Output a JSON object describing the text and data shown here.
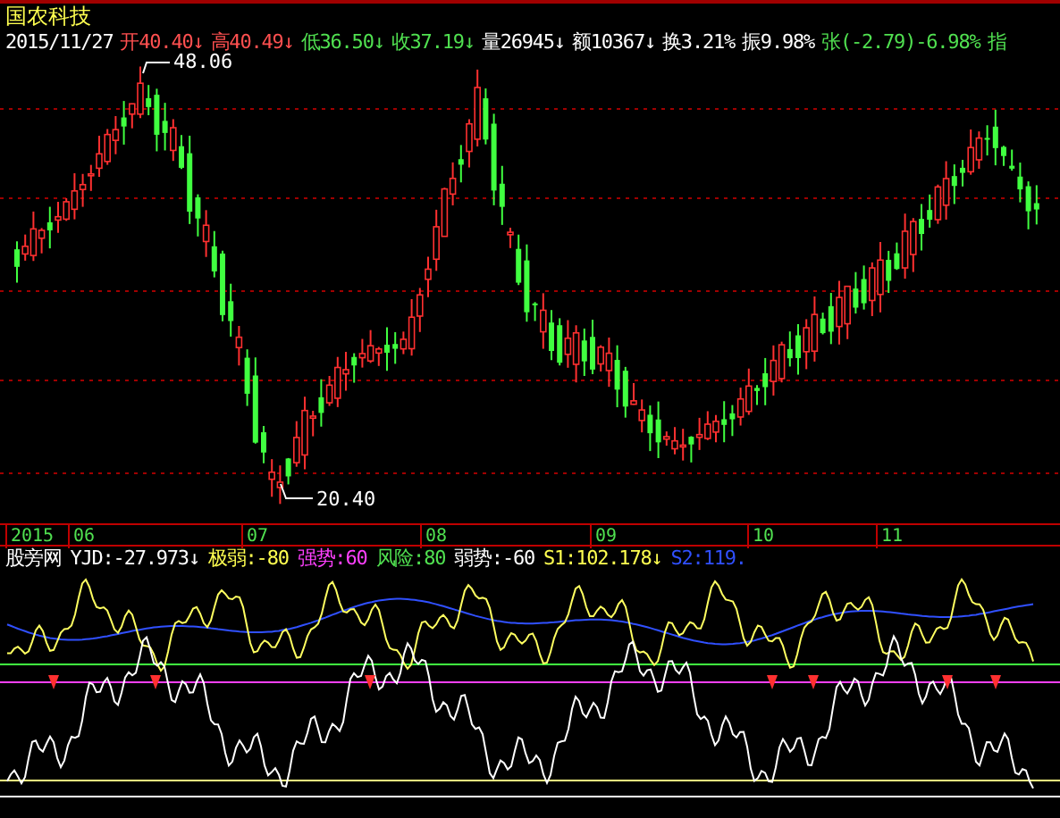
{
  "title": "国农科技",
  "quote": [
    {
      "text": "2015/11/27",
      "color": "#ffffff"
    },
    {
      "text": "开40.40↓",
      "color": "#ff5050"
    },
    {
      "text": "高40.49↓",
      "color": "#ff5050"
    },
    {
      "text": "低36.50↓",
      "color": "#50e050"
    },
    {
      "text": "收37.19↓",
      "color": "#50e050"
    },
    {
      "text": "量26945↓",
      "color": "#ffffff"
    },
    {
      "text": "额10367↓",
      "color": "#ffffff"
    },
    {
      "text": "换3.21%",
      "color": "#ffffff"
    },
    {
      "text": "振9.98%",
      "color": "#ffffff"
    },
    {
      "text": "张(-2.79)-6.98%",
      "color": "#50e050"
    },
    {
      "text": "指",
      "color": "#50e050"
    }
  ],
  "price_labels": {
    "high": "48.06",
    "low": "20.40"
  },
  "time_axis": [
    "2015",
    "06",
    "07",
    "08",
    "09",
    "10",
    "11"
  ],
  "indicator": {
    "name": "股旁网",
    "items": [
      {
        "text": "YJD:-27.973↓",
        "color": "#ffffff"
      },
      {
        "text": "极弱:-80",
        "color": "#ffff50"
      },
      {
        "text": "强势:60",
        "color": "#ff40ff"
      },
      {
        "text": "风险:80",
        "color": "#50e050"
      },
      {
        "text": "弱势:-60",
        "color": "#ffffff"
      },
      {
        "text": "S1:102.178↓",
        "color": "#ffff50"
      },
      {
        "text": "S2:119.",
        "color": "#3050ff"
      }
    ]
  }
}
